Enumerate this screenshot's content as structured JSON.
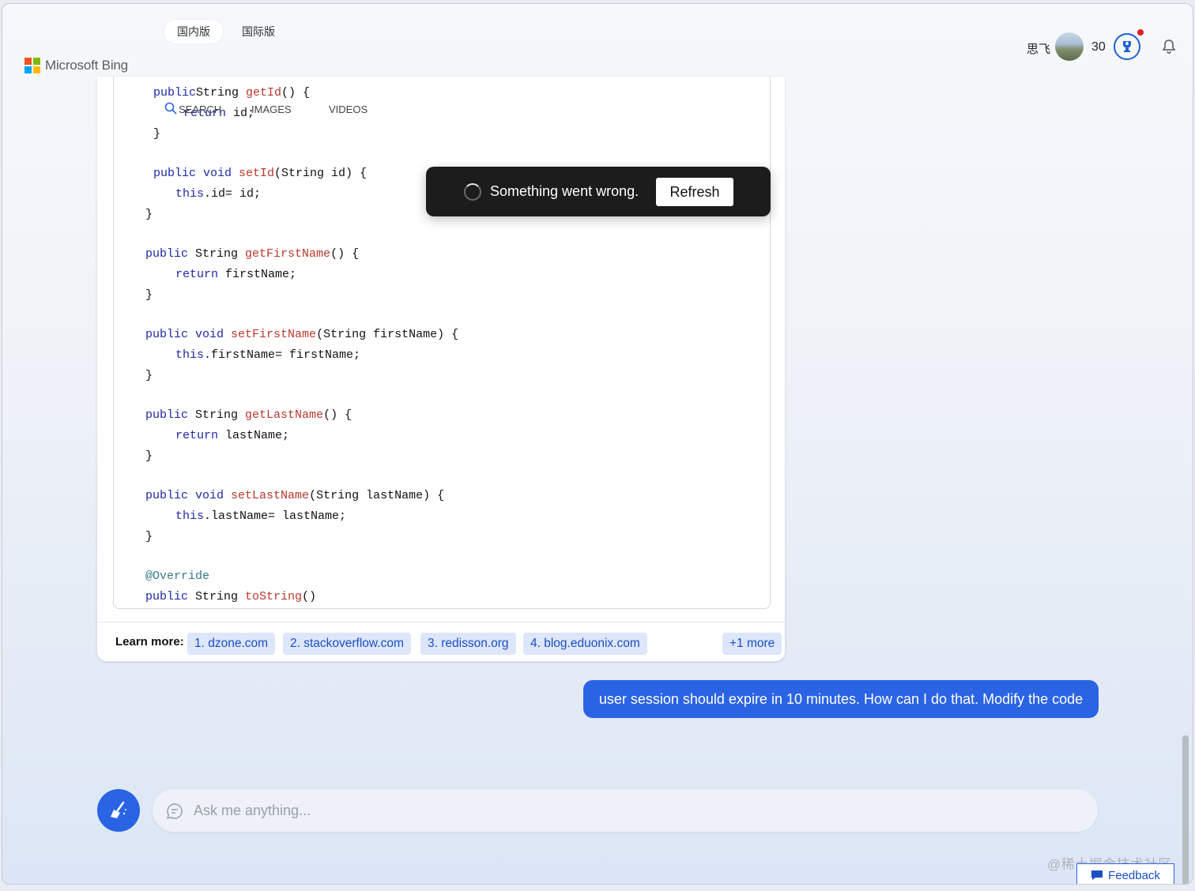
{
  "header": {
    "region_tabs": [
      "国内版",
      "国际版"
    ],
    "brand": "Microsoft Bing",
    "nav": [
      "SEARCH",
      "IMAGES",
      "VIDEOS"
    ],
    "user": {
      "name": "思飞",
      "points": "30"
    }
  },
  "code_lines": [
    {
      "t": [
        [
          "kw",
          "public"
        ],
        [
          "",
          "String "
        ],
        [
          "fn",
          "getId"
        ],
        [
          "",
          "() {"
        ]
      ]
    },
    {
      "t": [
        [
          "kw",
          "return"
        ],
        [
          "",
          " id;"
        ]
      ]
    },
    {
      "t": [
        [
          "",
          "}"
        ]
      ]
    },
    {
      "t": [
        [
          "kw",
          "public void "
        ],
        [
          "fn",
          "setId"
        ],
        [
          "",
          "(String id) {"
        ]
      ]
    },
    {
      "t": [
        [
          "kw",
          "this"
        ],
        [
          "",
          ".id= id;"
        ]
      ]
    },
    {
      "t": [
        [
          "",
          "}"
        ]
      ]
    },
    {
      "t": [
        [
          "kw",
          "public"
        ],
        [
          "",
          " String "
        ],
        [
          "fn",
          "getFirstName"
        ],
        [
          "",
          "() {"
        ]
      ]
    },
    {
      "t": [
        [
          "kw",
          "return"
        ],
        [
          "",
          " firstName;"
        ]
      ]
    },
    {
      "t": [
        [
          "",
          "}"
        ]
      ]
    },
    {
      "t": [
        [
          "kw",
          "public void "
        ],
        [
          "fn",
          "setFirstName"
        ],
        [
          "",
          "(String firstName) {"
        ]
      ]
    },
    {
      "t": [
        [
          "kw",
          "this"
        ],
        [
          "",
          ".firstName= firstName;"
        ]
      ]
    },
    {
      "t": [
        [
          "",
          "}"
        ]
      ]
    },
    {
      "t": [
        [
          "kw",
          "public"
        ],
        [
          "",
          " String "
        ],
        [
          "fn",
          "getLastName"
        ],
        [
          "",
          "() {"
        ]
      ]
    },
    {
      "t": [
        [
          "kw",
          "return"
        ],
        [
          "",
          " lastName;"
        ]
      ]
    },
    {
      "t": [
        [
          "",
          "}"
        ]
      ]
    },
    {
      "t": [
        [
          "kw",
          "public void "
        ],
        [
          "fn",
          "setLastName"
        ],
        [
          "",
          "(String lastName) {"
        ]
      ]
    },
    {
      "t": [
        [
          "kw",
          "this"
        ],
        [
          "",
          ".lastName= lastName;"
        ]
      ]
    },
    {
      "t": [
        [
          "",
          "}"
        ]
      ]
    },
    {
      "t": [
        [
          "an",
          "@Override"
        ]
      ]
    },
    {
      "t": [
        [
          "kw",
          "public"
        ],
        [
          "",
          " String "
        ],
        [
          "fn",
          "toString"
        ],
        [
          "",
          "()"
        ]
      ]
    }
  ],
  "learn_more": {
    "label": "Learn more:",
    "links": [
      "1. dzone.com",
      "2. stackoverflow.com",
      "3. redisson.org",
      "4. blog.eduonix.com"
    ],
    "more": "+1 more"
  },
  "error_toast": {
    "message": "Something went wrong.",
    "button": "Refresh"
  },
  "user_message": "user session should expire in 10 minutes. How can I do that. Modify the code",
  "input": {
    "placeholder": "Ask me anything..."
  },
  "footer": {
    "watermark": "@稀土掘金技术社区",
    "feedback": "Feedback"
  }
}
